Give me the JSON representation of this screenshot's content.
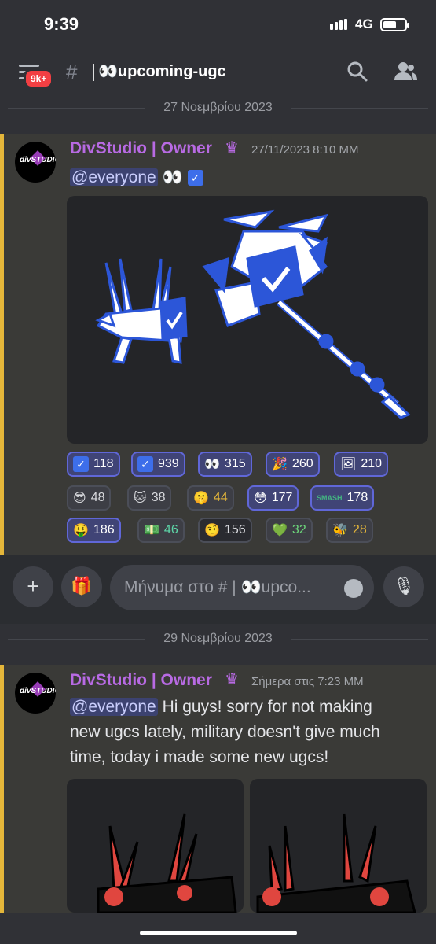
{
  "status": {
    "time": "9:39",
    "network": "4G"
  },
  "header": {
    "badge": "9k+",
    "hash": "#",
    "channel": "👀upcoming-ugc"
  },
  "dates": {
    "first": "27 Νοεμβρίου 2023",
    "second": "29 Νοεμβρίου 2023"
  },
  "msg1": {
    "username": "DivStudio | Owner",
    "timestamp": "27/11/2023 8:10 ΜΜ",
    "mention": "@everyone",
    "eyes": "👀",
    "reactions": [
      {
        "emoji": "check",
        "count": "118",
        "active": true
      },
      {
        "emoji": "check",
        "count": "939",
        "active": true
      },
      {
        "emoji": "👀",
        "count": "315",
        "active": true
      },
      {
        "emoji": "🎉",
        "count": "260",
        "active": true
      },
      {
        "emoji": "🖼",
        "count": "210",
        "active": true
      },
      {
        "emoji": "😎",
        "count": "48",
        "active": false
      },
      {
        "emoji": "🐱",
        "count": "38",
        "active": false
      },
      {
        "emoji": "🤫",
        "count": "44",
        "active": false
      },
      {
        "emoji": "😳",
        "count": "177",
        "active": true
      },
      {
        "emoji": "SMASH",
        "count": "178",
        "active": true
      },
      {
        "emoji": "🤑",
        "count": "186",
        "active": true
      },
      {
        "emoji": "💵",
        "count": "46",
        "active": false
      },
      {
        "emoji": "🤨",
        "count": "156",
        "active": false
      },
      {
        "emoji": "💚",
        "count": "32",
        "active": false
      },
      {
        "emoji": "🐝",
        "count": "28",
        "active": false
      }
    ]
  },
  "composer": {
    "placeholder": "Μήνυμα στο # | 👀upco...",
    "plus": "+",
    "gift": "🎁",
    "mic": "🎙"
  },
  "msg2": {
    "username": "DivStudio | Owner",
    "timestamp": "Σήμερα στις 7:23 ΜΜ",
    "mention": "@everyone",
    "line1": "Hi guys! sorry for not making",
    "line2": "new ugcs lately, military doesn't give much",
    "line3": "time, today i made some new ugcs!"
  },
  "avatar_text": "divSTUDIO",
  "colors": {
    "accent": "#3d6eea",
    "username": "#b86ae3",
    "highlight": "#e4b63a",
    "red_ugc": "#e0463f"
  }
}
